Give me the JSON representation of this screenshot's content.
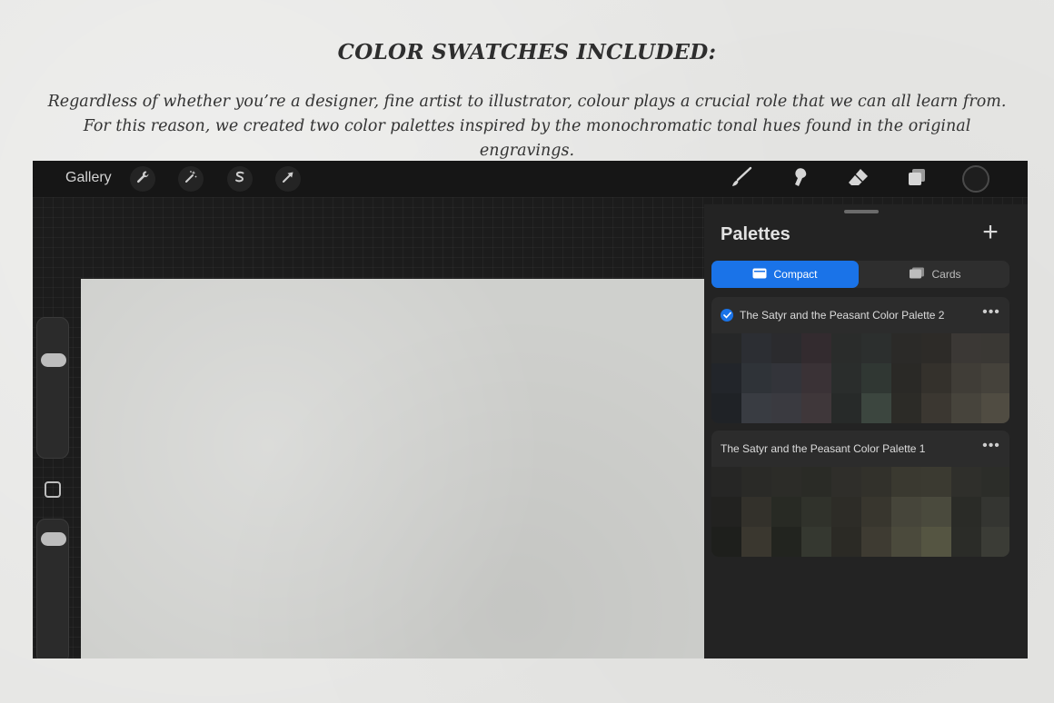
{
  "heading": "COLOR SWATCHES INCLUDED:",
  "intro": "Regardless of whether you’re a designer, fine artist to illustrator, colour plays a crucial role that we can all learn from. For this reason, we created two color palettes inspired by the monochromatic tonal hues found in the original engravings.",
  "toolbar": {
    "gallery": "Gallery",
    "left_tools": [
      "wrench-icon",
      "magic-wand-icon",
      "selection-icon",
      "transform-arrow-icon"
    ],
    "right_tools": [
      "brush-icon",
      "smudge-icon",
      "eraser-icon",
      "layers-icon"
    ],
    "current_color": "#1e1e1e"
  },
  "colors": {
    "accent": "#1a73e8",
    "panel": "#232323",
    "canvas": "#cfd0cd"
  },
  "sidebar": {
    "brush_size_level": 0.25,
    "opacity_level": 0.05
  },
  "panel": {
    "title": "Palettes",
    "tabs": [
      {
        "label": "Compact",
        "active": true
      },
      {
        "label": "Cards",
        "active": false
      }
    ],
    "palettes": [
      {
        "name": "The Satyr and the Peasant Color Palette 2",
        "default": true,
        "swatches": [
          "#262728",
          "#2c2e33",
          "#2b2b2e",
          "#332b2f",
          "#2a2c2b",
          "#2c2f2e",
          "#2b2a28",
          "#2d2b28",
          "#3b3835",
          "#3a3834",
          "#22252a",
          "#2f3338",
          "#33343a",
          "#3a3236",
          "#2a2d2c",
          "#303733",
          "#2a2926",
          "#34312c",
          "#403d37",
          "#45423b",
          "#1f2226",
          "#393c42",
          "#3a3a40",
          "#3f373a",
          "#272a29",
          "#3c463f",
          "#2c2b27",
          "#3b3731",
          "#47443c",
          "#504c42"
        ]
      },
      {
        "name": "The Satyr and the Peasant Color Palette 1",
        "default": false,
        "swatches": [
          "#262625",
          "#2a2a27",
          "#2c2c28",
          "#2a2b26",
          "#2f2e2a",
          "#32312b",
          "#3a3930",
          "#3b3a31",
          "#2f2f2b",
          "#2c2d29",
          "#222220",
          "#33312b",
          "#282a24",
          "#30322b",
          "#2d2c27",
          "#38362e",
          "#46453a",
          "#4a4a3d",
          "#2a2b27",
          "#343531",
          "#1e1f1c",
          "#3a372f",
          "#22241f",
          "#353830",
          "#2b2a25",
          "#3e3b32",
          "#4b4a3c",
          "#555542",
          "#2b2c28",
          "#3b3c36"
        ]
      }
    ]
  }
}
